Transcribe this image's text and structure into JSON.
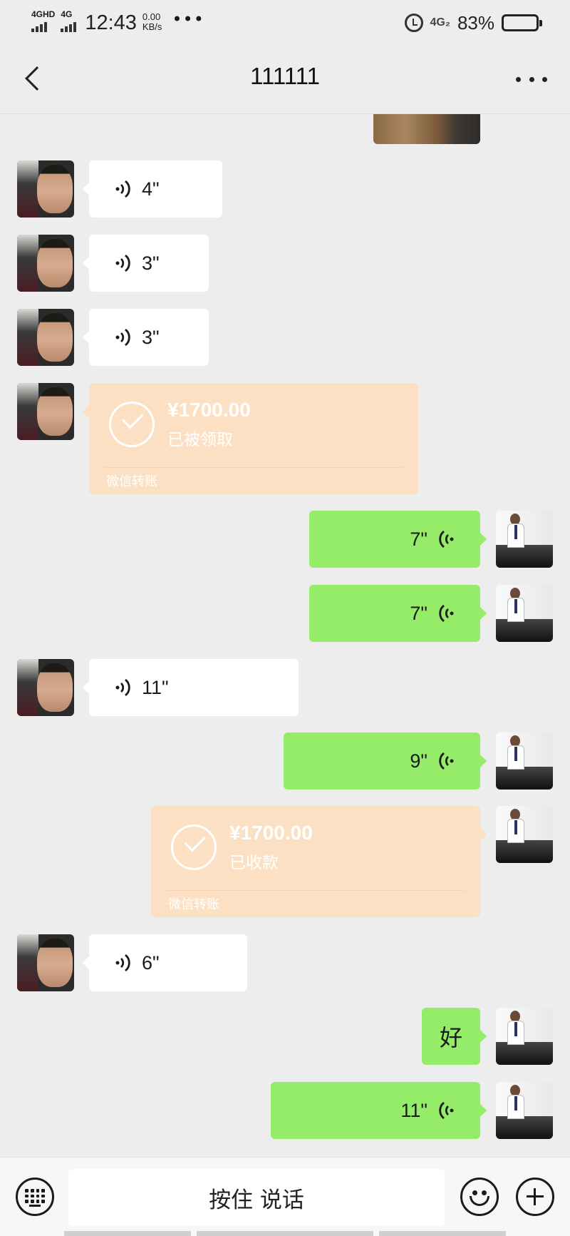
{
  "status_bar": {
    "network_1": "4GHD",
    "network_2": "4G",
    "time": "12:43",
    "speed_value": "0.00",
    "speed_unit": "KB/s",
    "more": "•••",
    "network_3": "4G₂",
    "battery_percent": "83%",
    "battery_level": 0.83
  },
  "header": {
    "title": "111111",
    "back_icon": "chevron-left-icon",
    "more_icon": "more-dots-icon"
  },
  "messages": [
    {
      "type": "voice",
      "direction": "in",
      "duration": "4\""
    },
    {
      "type": "voice",
      "direction": "in",
      "duration": "3\""
    },
    {
      "type": "voice",
      "direction": "in",
      "duration": "3\""
    },
    {
      "type": "transfer",
      "direction": "in",
      "amount": "¥1700.00",
      "status": "已被领取",
      "footer": "微信转账"
    },
    {
      "type": "voice",
      "direction": "out",
      "duration": "7\""
    },
    {
      "type": "voice",
      "direction": "out",
      "duration": "7\""
    },
    {
      "type": "voice",
      "direction": "in",
      "duration": "11\""
    },
    {
      "type": "voice",
      "direction": "out",
      "duration": "9\""
    },
    {
      "type": "transfer",
      "direction": "out",
      "amount": "¥1700.00",
      "status": "已收款",
      "footer": "微信转账"
    },
    {
      "type": "voice",
      "direction": "in",
      "duration": "6\""
    },
    {
      "type": "text",
      "direction": "out",
      "text": "好"
    },
    {
      "type": "voice",
      "direction": "out",
      "duration": "11\""
    }
  ],
  "input_bar": {
    "keyboard_icon": "keyboard-icon",
    "hold_to_talk_label": "按住 说话",
    "emoji_icon": "emoji-icon",
    "plus_icon": "plus-icon"
  },
  "colors": {
    "background": "#ededed",
    "incoming_bubble": "#ffffff",
    "outgoing_bubble": "#95ec69",
    "transfer_card": "#fbe0c4"
  }
}
